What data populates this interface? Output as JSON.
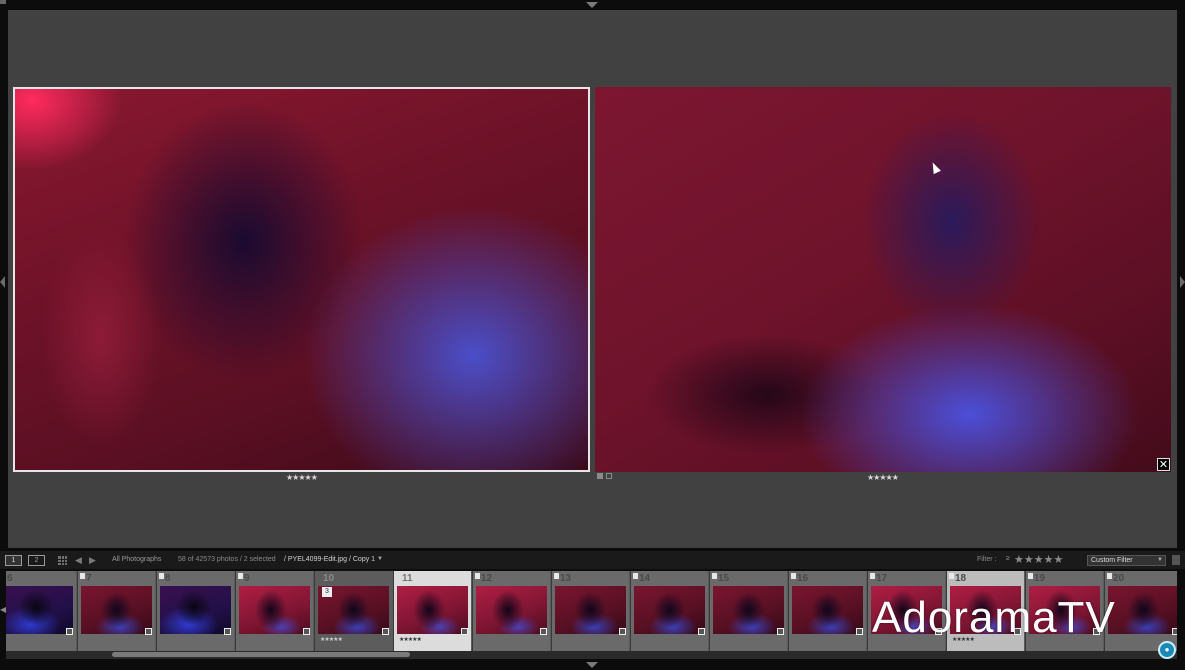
{
  "compare": {
    "select_rating": "★★★★★",
    "candidate_rating": "★★★★★",
    "close_label": "✕"
  },
  "filmstrip_bar": {
    "screen_1": "1",
    "screen_2": "2",
    "back": "◀",
    "forward": "▶",
    "source": "All Photographs",
    "count": "58 of 42573 photos / 2 selected",
    "filename": "/ PYEL4099-Edit.jpg / Copy 1",
    "filename_caret": "▼",
    "filter_label": "Filter :",
    "filter_operator": "≥",
    "filter_stars": "★★★★★",
    "custom_filter": "Custom Filter",
    "custom_filter_caret": "▼"
  },
  "filmstrip": {
    "cells": [
      {
        "num": "6",
        "stars": ""
      },
      {
        "num": "7",
        "stars": ""
      },
      {
        "num": "8",
        "stars": ""
      },
      {
        "num": "9",
        "stars": ""
      },
      {
        "num": "10",
        "stars": "★★★★★",
        "stack": "3"
      },
      {
        "num": "11",
        "stars": "★★★★★"
      },
      {
        "num": "12",
        "stars": ""
      },
      {
        "num": "13",
        "stars": ""
      },
      {
        "num": "14",
        "stars": ""
      },
      {
        "num": "15",
        "stars": ""
      },
      {
        "num": "16",
        "stars": ""
      },
      {
        "num": "17",
        "stars": ""
      },
      {
        "num": "18",
        "stars": "★★★★★"
      },
      {
        "num": "19",
        "stars": ""
      },
      {
        "num": "20",
        "stars": ""
      }
    ]
  },
  "watermark": {
    "brand": "Adorama",
    "suffix": "TV"
  },
  "colors": {
    "panel_bg": "#414141",
    "app_bg": "#0c0c0c",
    "selection_border": "#e6e6e6",
    "brand_badge": "#1a8ab8"
  },
  "icons": [
    "grid-view-icon",
    "back-arrow-icon",
    "forward-arrow-icon",
    "flag-icon",
    "close-icon",
    "camera-icon",
    "edit-badge-icon"
  ]
}
